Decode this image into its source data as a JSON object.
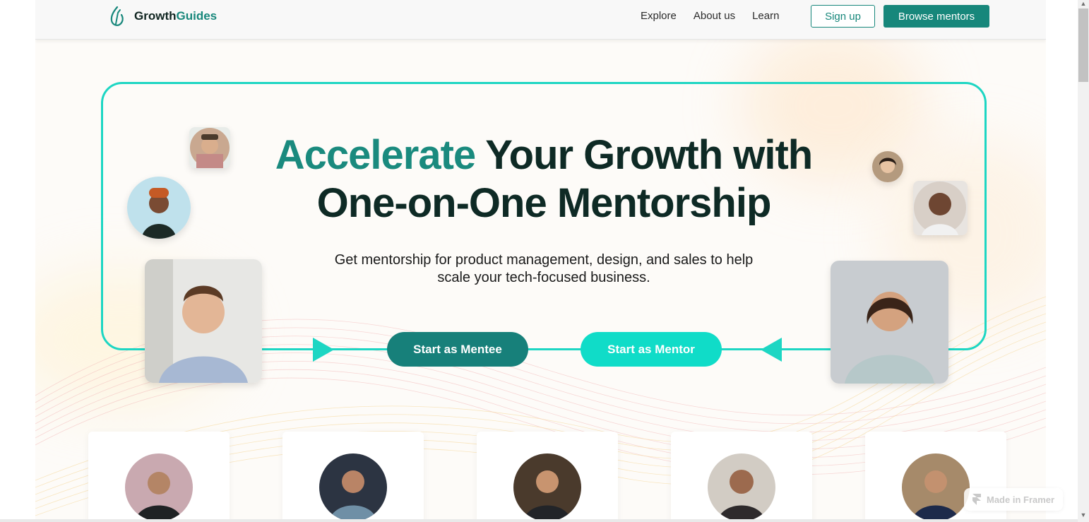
{
  "brand": {
    "name_part1": "Growth",
    "name_part2": "Guides"
  },
  "nav": {
    "items": [
      {
        "label": "Explore"
      },
      {
        "label": "About us"
      },
      {
        "label": "Learn"
      }
    ]
  },
  "header": {
    "signup_label": "Sign up",
    "browse_label": "Browse mentors"
  },
  "hero": {
    "title_accent": "Accelerate",
    "title_line1_rest": " Your Growth with",
    "title_line2": "One-on-One Mentorship",
    "subtitle_line1": "Get mentorship for product management, design, and sales to help",
    "subtitle_line2": "scale your tech-focused business.",
    "cta_mentee": "Start as Mentee",
    "cta_mentor": "Start as Mentor"
  },
  "badge": {
    "label": "Made in Framer"
  },
  "colors": {
    "brand": "#17877b",
    "accent": "#1dd6c3",
    "mentor_button": "#10dcc8",
    "heading": "#0e2a25"
  },
  "icons": [
    "logo-icon",
    "framer-icon",
    "scroll-up-icon",
    "scroll-down-icon"
  ]
}
